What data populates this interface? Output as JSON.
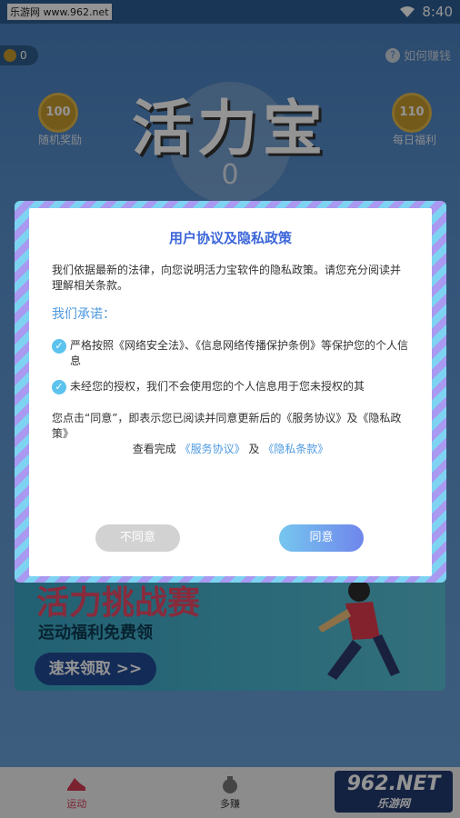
{
  "status_bar": {
    "watermark": "乐游网 www.962.net",
    "time": "8:40"
  },
  "header": {
    "coin_count": "0",
    "how_earn": "如何赚钱"
  },
  "app": {
    "title": "活力宝",
    "left_coin": {
      "value": "100",
      "label": "随机奖励"
    },
    "right_coin": {
      "value": "110",
      "label": "每日福利"
    },
    "center_value": "0"
  },
  "banner": {
    "headline": "活力挑战赛",
    "subtitle": "运动福利免费领",
    "button": "速来领取 >>"
  },
  "dialog": {
    "title": "用户协议及隐私政策",
    "intro": "我们依据最新的法律，向您说明活力宝软件的隐私政策。请您充分阅读并理解相关条款。",
    "promise_heading": "我们承诺：",
    "promise_1": "严格按照《网络安全法》、《信息网络传播保护条例》等保护您的个人信息",
    "promise_2": "未经您的授权，我们不会使用您的个人信息用于您未授权的其",
    "agree_text": "您点击“同意”，即表示您已阅读并同意更新后的《服务协议》及《隐私政策》",
    "view_prefix": "查看完成",
    "link_service": "《服务协议》",
    "and": "及",
    "link_privacy": "《隐私条款》",
    "decline_label": "不同意",
    "agree_label": "同意"
  },
  "tabbar": {
    "tab_sport": "运动",
    "tab_earn": "多赚"
  },
  "brand_logo": {
    "number": "962",
    "suffix": ".NET",
    "name": "乐游网"
  }
}
